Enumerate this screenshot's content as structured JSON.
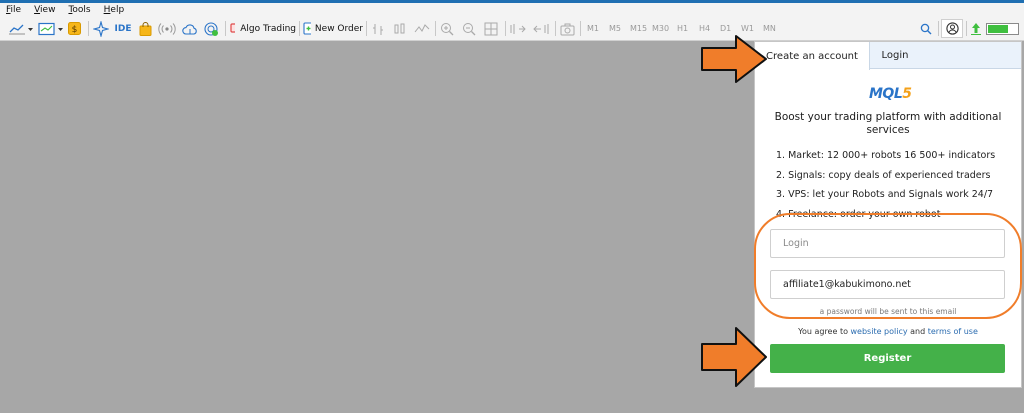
{
  "menu": {
    "file": {
      "underline": "F",
      "rest": "ile"
    },
    "view": {
      "underline": "V",
      "rest": "iew"
    },
    "tools": {
      "underline": "T",
      "rest": "ools"
    },
    "help": {
      "underline": "H",
      "rest": "elp"
    }
  },
  "toolbar": {
    "ide_label": "IDE",
    "algo_trading_label": "Algo Trading",
    "new_order_label": "New Order",
    "timeframes": [
      "M1",
      "M5",
      "M15",
      "M30",
      "H1",
      "H4",
      "D1",
      "W1",
      "MN"
    ],
    "colors": {
      "accent": "#2a74c8",
      "algo_red": "#e04848",
      "signal_green": "#3fbf3f"
    }
  },
  "panel": {
    "tabs": {
      "create": "Create an account",
      "login": "Login"
    },
    "logo": {
      "main": "MQL",
      "accent": "5"
    },
    "headline": "Boost your trading platform with additional services",
    "features": [
      "1. Market: 12 000+ robots 16 500+ indicators",
      "2. Signals: copy deals of experienced traders",
      "3. VPS: let your Robots and Signals work 24/7",
      "4. Freelance: order your own robot"
    ],
    "login_placeholder": "Login",
    "email_value": "affiliate1@kabukimono.net",
    "password_hint": "a password will be sent to this email",
    "agree": {
      "prefix": "You agree to ",
      "policy": "website policy",
      "and": " and ",
      "terms": "terms of use"
    },
    "register_label": "Register",
    "colors": {
      "register": "#44b149",
      "annotation": "#f07d2a"
    }
  }
}
